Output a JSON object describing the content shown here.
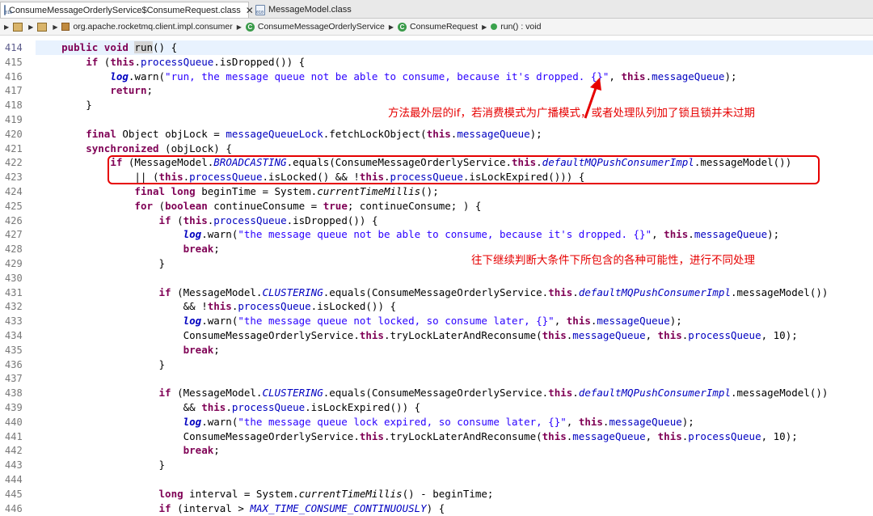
{
  "tabs": [
    {
      "label": "ConsumeMessageOrderlyService$ConsumeRequest.class",
      "close": "✕"
    },
    {
      "label": "MessageModel.class"
    }
  ],
  "breadcrumb": [
    "org.apache.rocketmq.client.impl.consumer",
    "ConsumeMessageOrderlyService",
    "ConsumeRequest",
    "run() : void"
  ],
  "annotations": {
    "note1": "方法最外层的if，若消费模式为广播模式，或者处理队列加了锁且锁并未过期",
    "note2": "往下继续判断大条件下所包含的各种可能性，进行不同处理"
  },
  "colors": {
    "annotation": "#e60000",
    "keyword": "#7f0055",
    "string": "#2a00ff",
    "field": "#0000c0"
  },
  "lines": [
    {
      "n": "414",
      "t": [
        [
          "",
          "    "
        ],
        [
          "kw",
          "public void "
        ],
        [
          "mark",
          "run"
        ],
        [
          "",
          "() {"
        ]
      ]
    },
    {
      "n": "415",
      "t": [
        [
          "",
          "        "
        ],
        [
          "kw",
          "if"
        ],
        [
          "",
          " ("
        ],
        [
          "kw",
          "this"
        ],
        [
          "",
          "."
        ],
        [
          "fld",
          "processQueue"
        ],
        [
          "",
          ".isDropped()) {"
        ]
      ]
    },
    {
      "n": "416",
      "t": [
        [
          "",
          "            "
        ],
        [
          "log",
          "log"
        ],
        [
          "",
          ".warn("
        ],
        [
          "str",
          "\"run, the message queue not be able to consume, because it's dropped. {}\""
        ],
        [
          "",
          ", "
        ],
        [
          "kw",
          "this"
        ],
        [
          "",
          "."
        ],
        [
          "fld",
          "messageQueue"
        ],
        [
          "",
          ");"
        ]
      ]
    },
    {
      "n": "417",
      "t": [
        [
          "",
          "            "
        ],
        [
          "kw",
          "return"
        ],
        [
          "",
          ";"
        ]
      ]
    },
    {
      "n": "418",
      "t": [
        [
          "",
          "        }"
        ]
      ]
    },
    {
      "n": "419",
      "t": [
        [
          "",
          ""
        ]
      ]
    },
    {
      "n": "420",
      "t": [
        [
          "",
          "        "
        ],
        [
          "kw",
          "final"
        ],
        [
          "",
          " Object objLock = "
        ],
        [
          "fld",
          "messageQueueLock"
        ],
        [
          "",
          ".fetchLockObject("
        ],
        [
          "kw",
          "this"
        ],
        [
          "",
          "."
        ],
        [
          "fld",
          "messageQueue"
        ],
        [
          "",
          ");"
        ]
      ]
    },
    {
      "n": "421",
      "t": [
        [
          "",
          "        "
        ],
        [
          "kw",
          "synchronized"
        ],
        [
          "",
          " (objLock) {"
        ]
      ]
    },
    {
      "n": "422",
      "t": [
        [
          "",
          "            "
        ],
        [
          "kw",
          "if"
        ],
        [
          "",
          " (MessageModel."
        ],
        [
          "ifld",
          "BROADCASTING"
        ],
        [
          "",
          ".equals(ConsumeMessageOrderlyService."
        ],
        [
          "kw",
          "this"
        ],
        [
          "",
          "."
        ],
        [
          "ifld",
          "defaultMQPushConsumerImpl"
        ],
        [
          "",
          ".messageModel())"
        ]
      ]
    },
    {
      "n": "423",
      "t": [
        [
          "",
          "                || ("
        ],
        [
          "kw",
          "this"
        ],
        [
          "",
          "."
        ],
        [
          "fld",
          "processQueue"
        ],
        [
          "",
          ".isLocked() && !"
        ],
        [
          "kw",
          "this"
        ],
        [
          "",
          "."
        ],
        [
          "fld",
          "processQueue"
        ],
        [
          "",
          ".isLockExpired())) {"
        ]
      ]
    },
    {
      "n": "424",
      "t": [
        [
          "",
          "                "
        ],
        [
          "kw",
          "final long"
        ],
        [
          "",
          " beginTime = System."
        ],
        [
          "ital",
          "currentTimeMillis"
        ],
        [
          "",
          "();"
        ]
      ]
    },
    {
      "n": "425",
      "t": [
        [
          "",
          "                "
        ],
        [
          "kw",
          "for"
        ],
        [
          "",
          " ("
        ],
        [
          "kw",
          "boolean"
        ],
        [
          "",
          " continueConsume = "
        ],
        [
          "kw",
          "true"
        ],
        [
          "",
          "; continueConsume; ) {"
        ]
      ]
    },
    {
      "n": "426",
      "t": [
        [
          "",
          "                    "
        ],
        [
          "kw",
          "if"
        ],
        [
          "",
          " ("
        ],
        [
          "kw",
          "this"
        ],
        [
          "",
          "."
        ],
        [
          "fld",
          "processQueue"
        ],
        [
          "",
          ".isDropped()) {"
        ]
      ]
    },
    {
      "n": "427",
      "t": [
        [
          "",
          "                        "
        ],
        [
          "log",
          "log"
        ],
        [
          "",
          ".warn("
        ],
        [
          "str",
          "\"the message queue not be able to consume, because it's dropped. {}\""
        ],
        [
          "",
          ", "
        ],
        [
          "kw",
          "this"
        ],
        [
          "",
          "."
        ],
        [
          "fld",
          "messageQueue"
        ],
        [
          "",
          ");"
        ]
      ]
    },
    {
      "n": "428",
      "t": [
        [
          "",
          "                        "
        ],
        [
          "kw",
          "break"
        ],
        [
          "",
          ";"
        ]
      ]
    },
    {
      "n": "429",
      "t": [
        [
          "",
          "                    }"
        ]
      ]
    },
    {
      "n": "430",
      "t": [
        [
          "",
          ""
        ]
      ]
    },
    {
      "n": "431",
      "t": [
        [
          "",
          "                    "
        ],
        [
          "kw",
          "if"
        ],
        [
          "",
          " (MessageModel."
        ],
        [
          "ifld",
          "CLUSTERING"
        ],
        [
          "",
          ".equals(ConsumeMessageOrderlyService."
        ],
        [
          "kw",
          "this"
        ],
        [
          "",
          "."
        ],
        [
          "ifld",
          "defaultMQPushConsumerImpl"
        ],
        [
          "",
          ".messageModel())"
        ]
      ]
    },
    {
      "n": "432",
      "t": [
        [
          "",
          "                        && !"
        ],
        [
          "kw",
          "this"
        ],
        [
          "",
          "."
        ],
        [
          "fld",
          "processQueue"
        ],
        [
          "",
          ".isLocked()) {"
        ]
      ]
    },
    {
      "n": "433",
      "t": [
        [
          "",
          "                        "
        ],
        [
          "log",
          "log"
        ],
        [
          "",
          ".warn("
        ],
        [
          "str",
          "\"the message queue not locked, so consume later, {}\""
        ],
        [
          "",
          ", "
        ],
        [
          "kw",
          "this"
        ],
        [
          "",
          "."
        ],
        [
          "fld",
          "messageQueue"
        ],
        [
          "",
          ");"
        ]
      ]
    },
    {
      "n": "434",
      "t": [
        [
          "",
          "                        ConsumeMessageOrderlyService."
        ],
        [
          "kw",
          "this"
        ],
        [
          "",
          ".tryLockLaterAndReconsume("
        ],
        [
          "kw",
          "this"
        ],
        [
          "",
          "."
        ],
        [
          "fld",
          "messageQueue"
        ],
        [
          "",
          ", "
        ],
        [
          "kw",
          "this"
        ],
        [
          "",
          "."
        ],
        [
          "fld",
          "processQueue"
        ],
        [
          "",
          ", 10);"
        ]
      ]
    },
    {
      "n": "435",
      "t": [
        [
          "",
          "                        "
        ],
        [
          "kw",
          "break"
        ],
        [
          "",
          ";"
        ]
      ]
    },
    {
      "n": "436",
      "t": [
        [
          "",
          "                    }"
        ]
      ]
    },
    {
      "n": "437",
      "t": [
        [
          "",
          ""
        ]
      ]
    },
    {
      "n": "438",
      "t": [
        [
          "",
          "                    "
        ],
        [
          "kw",
          "if"
        ],
        [
          "",
          " (MessageModel."
        ],
        [
          "ifld",
          "CLUSTERING"
        ],
        [
          "",
          ".equals(ConsumeMessageOrderlyService."
        ],
        [
          "kw",
          "this"
        ],
        [
          "",
          "."
        ],
        [
          "ifld",
          "defaultMQPushConsumerImpl"
        ],
        [
          "",
          ".messageModel())"
        ]
      ]
    },
    {
      "n": "439",
      "t": [
        [
          "",
          "                        && "
        ],
        [
          "kw",
          "this"
        ],
        [
          "",
          "."
        ],
        [
          "fld",
          "processQueue"
        ],
        [
          "",
          ".isLockExpired()) {"
        ]
      ]
    },
    {
      "n": "440",
      "t": [
        [
          "",
          "                        "
        ],
        [
          "log",
          "log"
        ],
        [
          "",
          ".warn("
        ],
        [
          "str",
          "\"the message queue lock expired, so consume later, {}\""
        ],
        [
          "",
          ", "
        ],
        [
          "kw",
          "this"
        ],
        [
          "",
          "."
        ],
        [
          "fld",
          "messageQueue"
        ],
        [
          "",
          ");"
        ]
      ]
    },
    {
      "n": "441",
      "t": [
        [
          "",
          "                        ConsumeMessageOrderlyService."
        ],
        [
          "kw",
          "this"
        ],
        [
          "",
          ".tryLockLaterAndReconsume("
        ],
        [
          "kw",
          "this"
        ],
        [
          "",
          "."
        ],
        [
          "fld",
          "messageQueue"
        ],
        [
          "",
          ", "
        ],
        [
          "kw",
          "this"
        ],
        [
          "",
          "."
        ],
        [
          "fld",
          "processQueue"
        ],
        [
          "",
          ", 10);"
        ]
      ]
    },
    {
      "n": "442",
      "t": [
        [
          "",
          "                        "
        ],
        [
          "kw",
          "break"
        ],
        [
          "",
          ";"
        ]
      ]
    },
    {
      "n": "443",
      "t": [
        [
          "",
          "                    }"
        ]
      ]
    },
    {
      "n": "444",
      "t": [
        [
          "",
          ""
        ]
      ]
    },
    {
      "n": "445",
      "t": [
        [
          "",
          "                    "
        ],
        [
          "kw",
          "long"
        ],
        [
          "",
          " interval = System."
        ],
        [
          "ital",
          "currentTimeMillis"
        ],
        [
          "",
          "() - beginTime;"
        ]
      ]
    },
    {
      "n": "446",
      "t": [
        [
          "",
          "                    "
        ],
        [
          "kw",
          "if"
        ],
        [
          "",
          " (interval > "
        ],
        [
          "ifld",
          "MAX_TIME_CONSUME_CONTINUOUSLY"
        ],
        [
          "",
          ") {"
        ]
      ]
    }
  ]
}
